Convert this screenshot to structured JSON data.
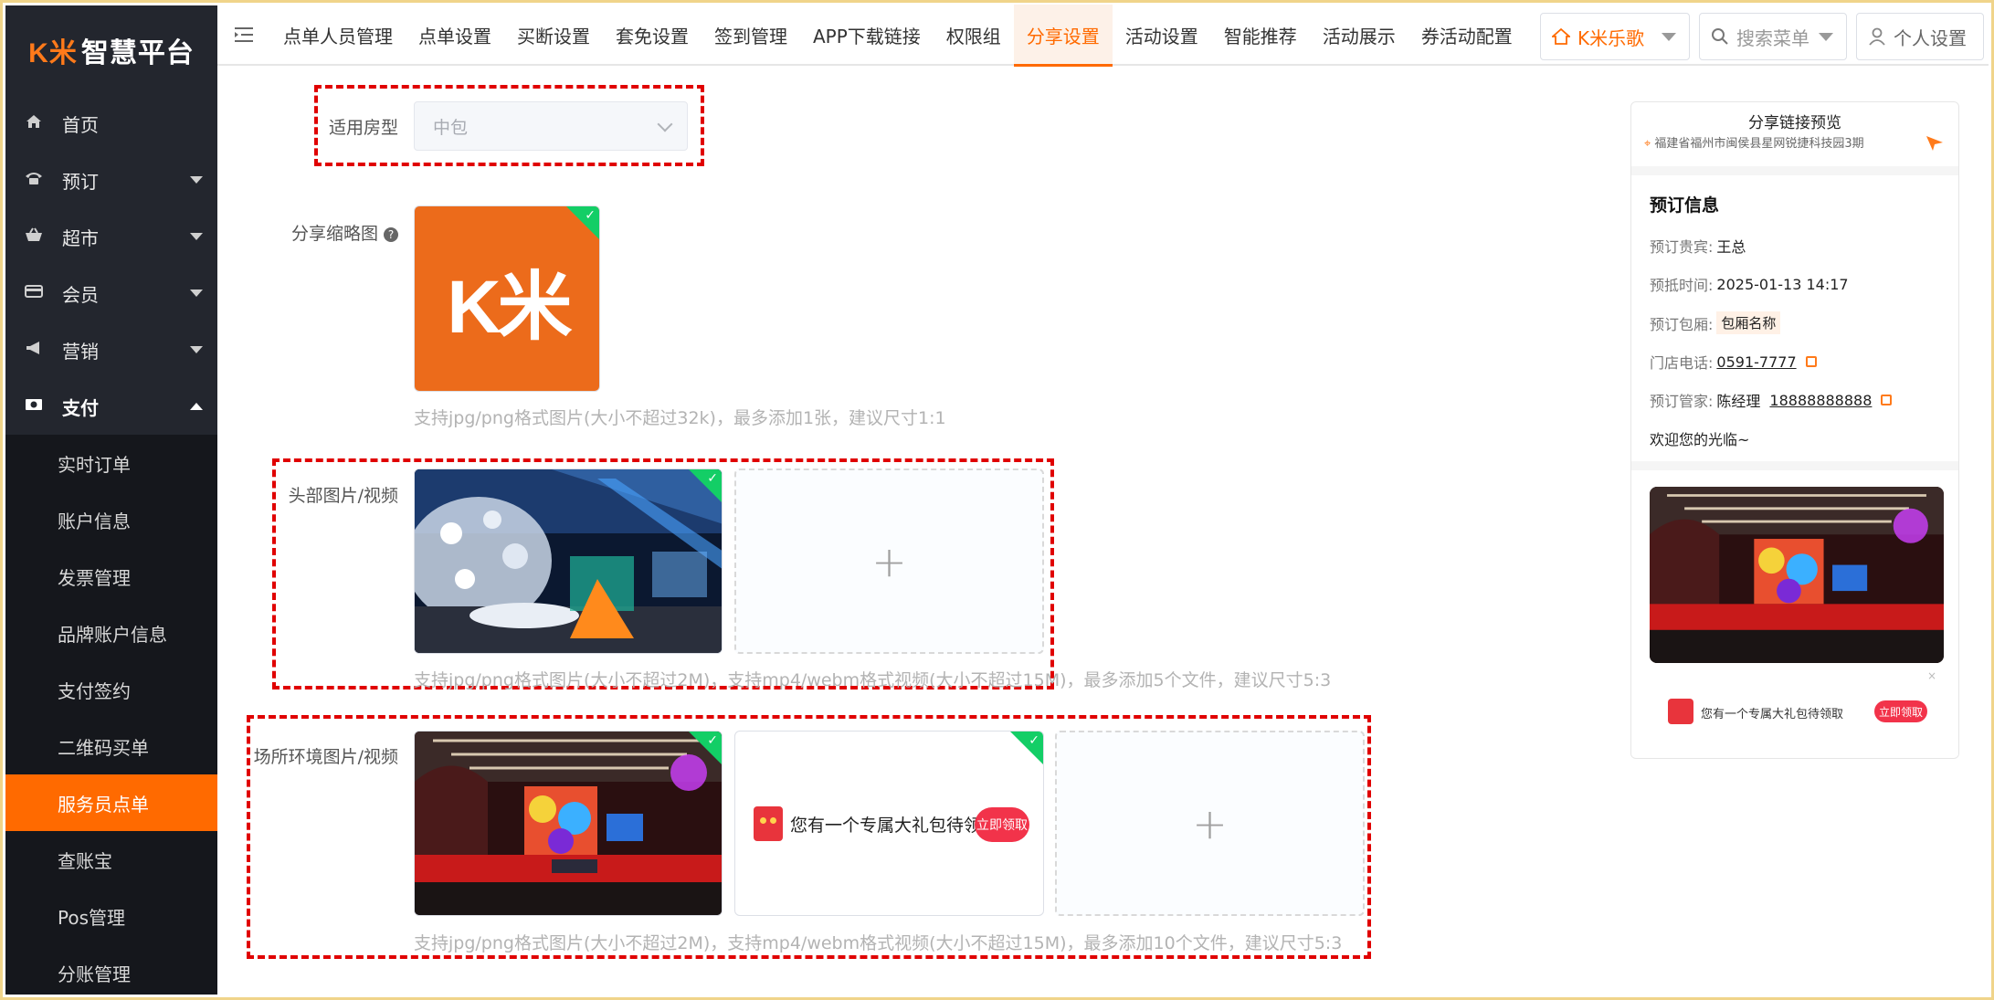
{
  "app": {
    "logo_mark": "K米",
    "logo_text": "智慧平台"
  },
  "sidebar": {
    "items": [
      {
        "label": "首页",
        "icon": "home-icon",
        "glyph": "⌂"
      },
      {
        "label": "预订",
        "icon": "phone-icon",
        "glyph": "☎"
      },
      {
        "label": "超市",
        "icon": "basket-icon",
        "glyph": "🧺"
      },
      {
        "label": "会员",
        "icon": "card-icon",
        "glyph": "▭"
      },
      {
        "label": "营销",
        "icon": "megaphone-icon",
        "glyph": "📢"
      },
      {
        "label": "支付",
        "icon": "cash-icon",
        "glyph": "▣"
      }
    ],
    "sub_items": [
      {
        "label": "实时订单"
      },
      {
        "label": "账户信息"
      },
      {
        "label": "发票管理"
      },
      {
        "label": "品牌账户信息"
      },
      {
        "label": "支付签约"
      },
      {
        "label": "二维码买单"
      },
      {
        "label": "服务员点单"
      },
      {
        "label": "查账宝"
      },
      {
        "label": "Pos管理"
      },
      {
        "label": "分账管理"
      }
    ],
    "active_sub": "服务员点单"
  },
  "topbar": {
    "tabs": [
      {
        "label": "点单人员管理"
      },
      {
        "label": "点单设置"
      },
      {
        "label": "买断设置"
      },
      {
        "label": "套免设置"
      },
      {
        "label": "签到管理"
      },
      {
        "label": "APP下载链接"
      },
      {
        "label": "权限组"
      },
      {
        "label": "分享设置"
      },
      {
        "label": "活动设置"
      },
      {
        "label": "智能推荐"
      },
      {
        "label": "活动展示"
      },
      {
        "label": "券活动配置"
      }
    ],
    "active_tab": "分享设置",
    "store_select": "K米乐歌",
    "menu_search_placeholder": "搜索菜单",
    "personal_settings": "个人设置"
  },
  "form": {
    "room_type_label": "适用房型",
    "room_type_value": "中包",
    "thumb_label": "分享缩略图",
    "thumb_hint": "支持jpg/png格式图片(大小不超过32k)，最多添加1张，建议尺寸1:1",
    "thumb_logo": "K米",
    "header_label": "头部图片/视频",
    "header_hint": "支持jpg/png格式图片(大小不超过2M)，支持mp4/webm格式视频(大小不超过15M)，最多添加5个文件，建议尺寸5:3",
    "env_label": "场所环境图片/视频",
    "env_hint": "支持jpg/png格式图片(大小不超过2M)，支持mp4/webm格式视频(大小不超过15M)，最多添加10个文件，建议尺寸5:3",
    "gift_banner_text": "您有一个专属大礼包待领取",
    "gift_banner_button": "立即领取",
    "add_symbol": "+"
  },
  "preview": {
    "title": "分享链接预览",
    "address": "福建省福州市闽侯县星网锐捷科技园3期",
    "section_title": "预订信息",
    "rows": {
      "guest_label": "预订贵宾:",
      "guest_value": "王总",
      "arrive_label": "预抵时间:",
      "arrive_value": "2025-01-13 14:17",
      "room_label": "预订包厢:",
      "room_value": "包厢名称",
      "phone_label": "门店电话:",
      "phone_value": "0591-7777",
      "manager_label": "预订管家:",
      "manager_name": "陈经理",
      "manager_phone": "18888888888",
      "welcome": "欢迎您的光临~"
    },
    "gift_text": "您有一个专属大礼包待领取",
    "gift_button": "立即领取",
    "close_mark": "×"
  },
  "colors": {
    "accent": "#ff6a00",
    "sidebar_bg": "#23262e",
    "annotation": "#e00000",
    "success": "#13ce66"
  }
}
